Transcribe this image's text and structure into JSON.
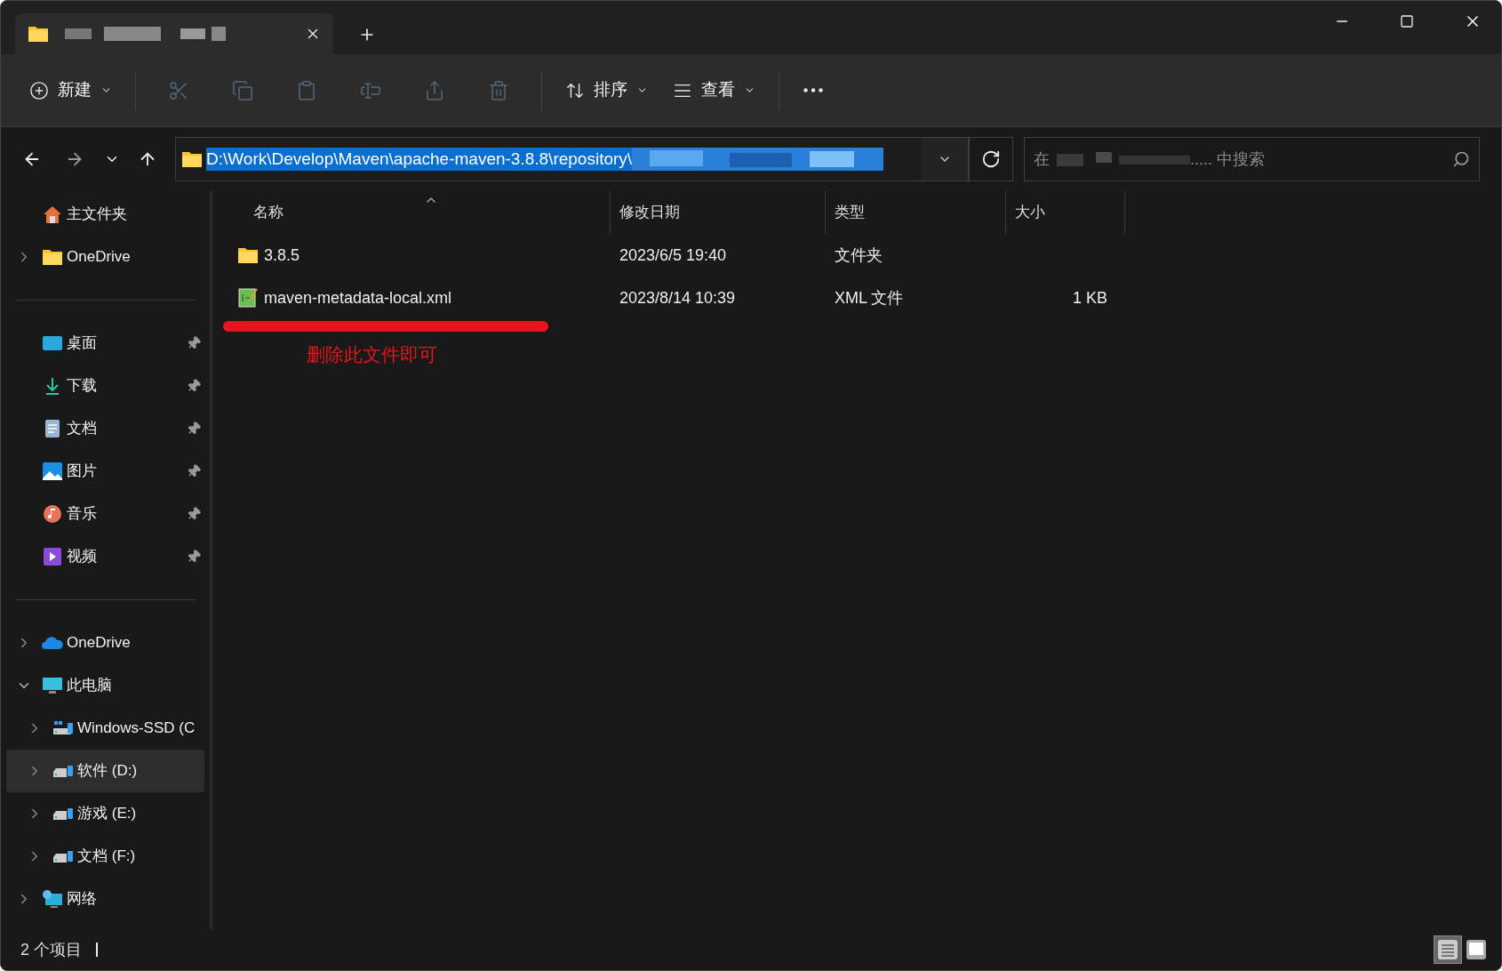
{
  "toolbar": {
    "items": [
      {
        "kind": "new",
        "label": "新建",
        "disabled": false
      },
      {
        "kind": "cut",
        "disabled": true
      },
      {
        "kind": "copy",
        "disabled": true
      },
      {
        "kind": "paste",
        "disabled": true
      },
      {
        "kind": "rename",
        "disabled": true
      },
      {
        "kind": "share",
        "disabled": true
      },
      {
        "kind": "delete",
        "disabled": true
      },
      {
        "kind": "sort",
        "label": "排序",
        "disabled": false
      },
      {
        "kind": "view",
        "label": "查看",
        "disabled": false
      },
      {
        "kind": "more",
        "disabled": false
      }
    ]
  },
  "address": {
    "path": "D:\\Work\\Develop\\Maven\\apache-maven-3.8.8\\repository\\"
  },
  "search": {
    "prefix": "在",
    "suffix": "..... 中搜索"
  },
  "sidebar": {
    "groups": [
      [
        {
          "label": "主文件夹",
          "kind": "home"
        },
        {
          "label": "OneDrive",
          "kind": "folder",
          "expanded": false
        }
      ],
      [
        {
          "label": "桌面",
          "kind": "desktop",
          "pinned": true
        },
        {
          "label": "下载",
          "kind": "download",
          "pinned": true
        },
        {
          "label": "文档",
          "kind": "document",
          "pinned": true
        },
        {
          "label": "图片",
          "kind": "picture",
          "pinned": true
        },
        {
          "label": "音乐",
          "kind": "music",
          "pinned": true
        },
        {
          "label": "视频",
          "kind": "video",
          "pinned": true
        }
      ],
      [
        {
          "label": "OneDrive",
          "kind": "cloud",
          "expanded": false,
          "selected": false
        },
        {
          "label": "此电脑",
          "kind": "pc",
          "expanded": true,
          "selected": false,
          "children": [
            {
              "label": "Windows-SSD (C",
              "kind": "windrive",
              "expanded": false,
              "selected": false
            },
            {
              "label": "软件 (D:)",
              "kind": "drive",
              "expanded": false,
              "selected": true
            },
            {
              "label": "游戏 (E:)",
              "kind": "drive",
              "expanded": false,
              "selected": false
            },
            {
              "label": "文档 (F:)",
              "kind": "drive",
              "expanded": false,
              "selected": false
            }
          ]
        },
        {
          "label": "网络",
          "kind": "network",
          "expanded": false,
          "selected": false
        }
      ]
    ]
  },
  "table": {
    "columns": [
      "名称",
      "修改日期",
      "类型",
      "大小"
    ],
    "rows": [
      {
        "kind": "folder",
        "name": "3.8.5",
        "modified": "2023/6/5 19:40",
        "type": "文件夹",
        "size": ""
      },
      {
        "kind": "xml",
        "name": "maven-metadata-local.xml",
        "modified": "2023/8/14 10:39",
        "type": "XML 文件",
        "size": "1 KB"
      }
    ]
  },
  "annotation": {
    "note": "删除此文件即可"
  },
  "status_bar": {
    "count": "2 个项目",
    "views": [
      {
        "kind": "details",
        "selected": true
      },
      {
        "kind": "tiles",
        "selected": false
      }
    ]
  }
}
